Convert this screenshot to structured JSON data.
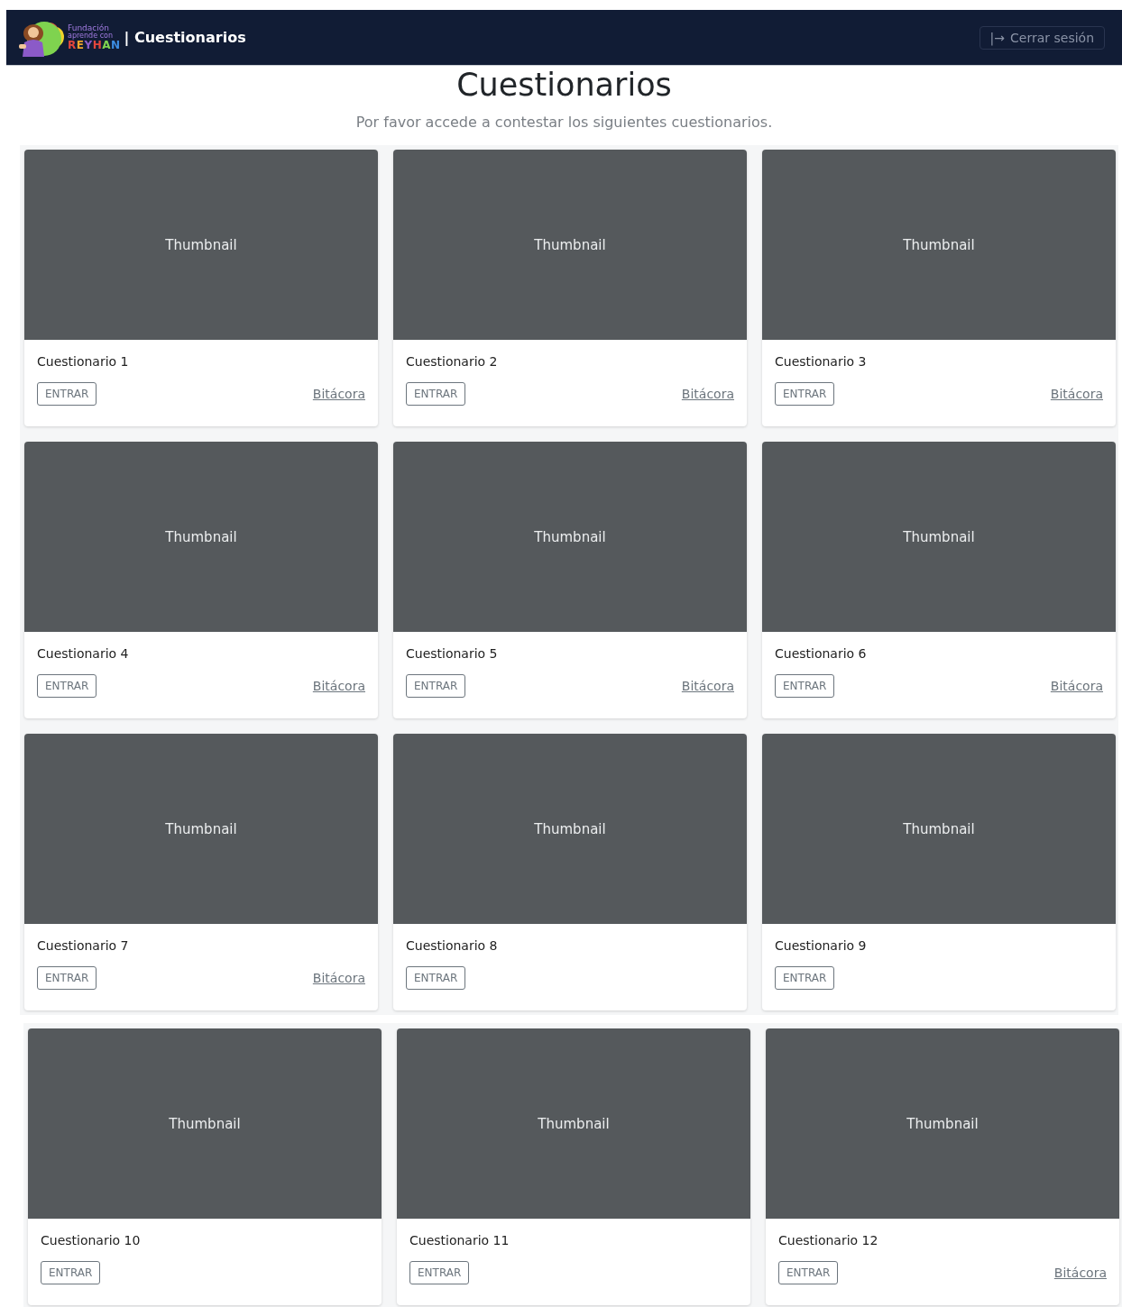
{
  "navbar": {
    "logo": {
      "line_1": "Fundación",
      "line_2": "aprende con",
      "line_3": "REYHAN"
    },
    "title": "| Cuestionarios",
    "logout_button": {
      "icon": "|→",
      "label": "Cerrar sesión"
    }
  },
  "heading": "Cuestionarios",
  "subtitle": "Por favor accede a contestar los siguientes cuestionarios.",
  "sections": [
    {
      "cards": [
        {
          "thumbnail": "Thumbnail",
          "title": "Cuestionario 1",
          "button": "ENTRAR",
          "link": "Bitácora"
        },
        {
          "thumbnail": "Thumbnail",
          "title": "Cuestionario 2",
          "button": "ENTRAR",
          "link": "Bitácora"
        },
        {
          "thumbnail": "Thumbnail",
          "title": "Cuestionario 3",
          "button": "ENTRAR",
          "link": "Bitácora"
        },
        {
          "thumbnail": "Thumbnail",
          "title": "Cuestionario 4",
          "button": "ENTRAR",
          "link": "Bitácora"
        },
        {
          "thumbnail": "Thumbnail",
          "title": "Cuestionario 5",
          "button": "ENTRAR",
          "link": "Bitácora"
        },
        {
          "thumbnail": "Thumbnail",
          "title": "Cuestionario 6",
          "button": "ENTRAR",
          "link": "Bitácora"
        },
        {
          "thumbnail": "Thumbnail",
          "title": "Cuestionario 7",
          "button": "ENTRAR",
          "link": "Bitácora"
        },
        {
          "thumbnail": "Thumbnail",
          "title": "Cuestionario 8",
          "button": "ENTRAR"
        },
        {
          "thumbnail": "Thumbnail",
          "title": "Cuestionario 9",
          "button": "ENTRAR"
        }
      ]
    },
    {
      "cards": [
        {
          "thumbnail": "Thumbnail",
          "title": "Cuestionario 10",
          "button": "ENTRAR"
        },
        {
          "thumbnail": "Thumbnail",
          "title": "Cuestionario 11",
          "button": "ENTRAR"
        },
        {
          "thumbnail": "Thumbnail",
          "title": "Cuestionario 12",
          "button": "ENTRAR",
          "link": "Bitácora"
        }
      ]
    }
  ]
}
